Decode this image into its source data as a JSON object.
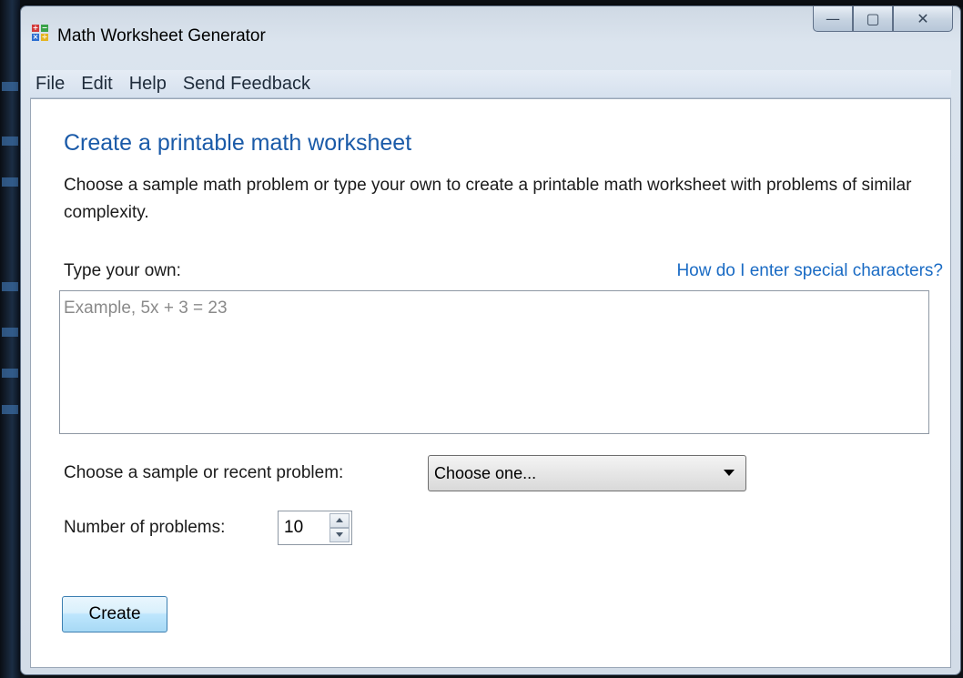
{
  "window": {
    "title": "Math Worksheet Generator",
    "controls": {
      "minimize": "—",
      "maximize": "▢",
      "close": "✕"
    }
  },
  "menu": {
    "items": [
      "File",
      "Edit",
      "Help",
      "Send Feedback"
    ]
  },
  "main": {
    "heading": "Create a printable math worksheet",
    "description": "Choose a sample math problem or type your own to create a printable math worksheet with problems of similar complexity.",
    "type_own_label": "Type your own:",
    "help_link": "How do I enter special characters?",
    "problem_input": {
      "placeholder": "Example, 5x + 3 = 23",
      "value": ""
    },
    "sample_label": "Choose a sample or recent problem:",
    "sample_select": {
      "selected": "Choose one..."
    },
    "count_label": "Number of problems:",
    "count_value": "10",
    "create_button": "Create"
  },
  "colors": {
    "heading": "#1a5aa8",
    "link": "#1a6bc4",
    "window_chrome": "#d2dce7"
  },
  "icons": {
    "app": "math-operators-icon",
    "minimize": "minimize-icon",
    "maximize": "maximize-icon",
    "close": "close-icon"
  }
}
